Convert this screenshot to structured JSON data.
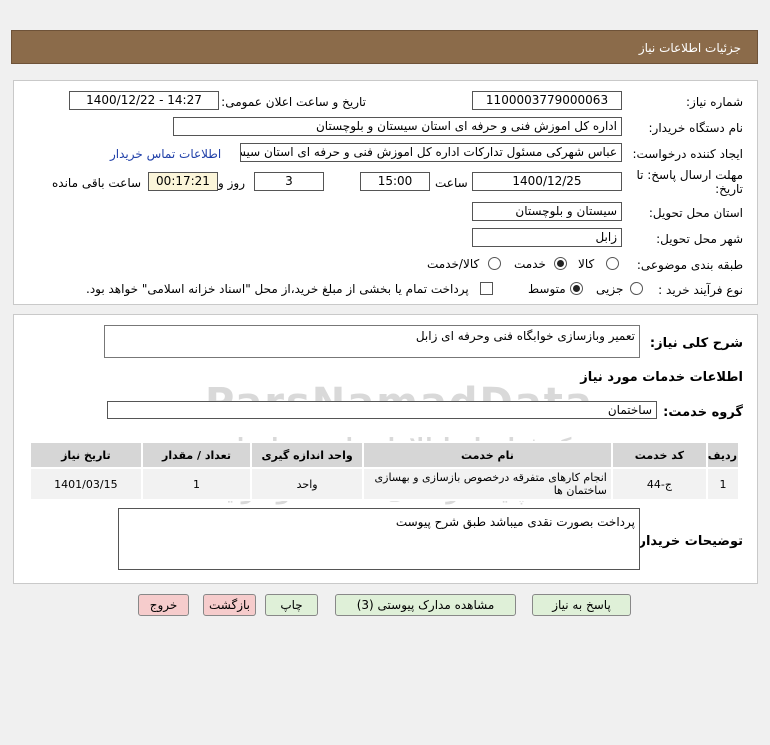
{
  "header": {
    "title": "جزئیات اطلاعات نیاز"
  },
  "details": {
    "need_number_label": "شماره نیاز:",
    "need_number": "1100003779000063",
    "announce_label": "تاریخ و ساعت اعلان عمومی:",
    "announce_value": "1400/12/22 - 14:27",
    "buyer_org_label": "نام دستگاه خریدار:",
    "buyer_org": "اداره کل اموزش فنی و حرفه ای استان سیستان و بلوچستان",
    "requester_label": "ایجاد کننده درخواست:",
    "requester": "عباس شهرکی مسئول تدارکات اداره کل اموزش فنی و حرفه ای استان سیستان",
    "contact_link": "اطلاعات تماس خریدار",
    "deadline_label_1": "مهلت ارسال پاسخ: تا",
    "deadline_label_2": "تاریخ:",
    "deadline_date": "1400/12/25",
    "time_label": "ساعت",
    "deadline_time": "15:00",
    "days_value": "3",
    "days_label": "روز و",
    "remaining_time": "00:17:21",
    "remaining_label": "ساعت باقی مانده",
    "province_label": "استان محل تحویل:",
    "province": "سیستان و بلوچستان",
    "city_label": "شهر محل تحویل:",
    "city": "زابل",
    "category_label": "طبقه بندی موضوعی:",
    "category_options": [
      "کالا",
      "خدمت",
      "کالا/خدمت"
    ],
    "category_selected": "خدمت",
    "process_label": "نوع فرآیند خرید :",
    "process_options": [
      "جزیی",
      "متوسط"
    ],
    "process_selected": "متوسط",
    "payment_text": "پرداخت تمام یا بخشی از مبلغ خرید،از محل \"اسناد خزانه اسلامی\" خواهد بود."
  },
  "summary": {
    "description_label": "شرح کلی نیاز:",
    "description": "تعمیر وبازسازی خوابگاه فنی وحرفه ای زابل",
    "services_title": "اطلاعات خدمات مورد نیاز",
    "service_group_label": "گروه خدمت:",
    "service_group": "ساختمان"
  },
  "table": {
    "columns": [
      "ردیف",
      "کد خدمت",
      "نام خدمت",
      "واحد اندازه گیری",
      "تعداد / مقدار",
      "تاریخ نیاز"
    ],
    "rows": [
      {
        "row": "1",
        "code": "ج-44",
        "name": "انجام کارهای متفرقه درخصوص بازسازی و بهسازی ساختمان ها",
        "unit": "واحد",
        "qty": "1",
        "date": "1401/03/15"
      }
    ]
  },
  "notes": {
    "label": "توضیحات خریدار:",
    "text": "پرداخت بصورت نقدی میباشد طبق شرح پیوست"
  },
  "buttons": {
    "reply": "پاسخ به نیاز",
    "view_docs": "مشاهده مدارک پیوستی (3)",
    "print": "چاپ",
    "back": "بازگشت",
    "exit": "خروج"
  },
  "watermark": {
    "brand": "ParsNamadData",
    "line1": "مرکز فراخوان اطلاعات پارس نماد داده",
    "line2": "پایگاه رسانی مناقصه و مزایده",
    "phone": "۰۲۱-۸۸۳۴۹۶۷۰-۸"
  },
  "colors": {
    "header_bg": "#8b6b4a",
    "button_green": "#dff0d8",
    "button_red": "#f6cccc",
    "link": "#1f3fa8"
  }
}
